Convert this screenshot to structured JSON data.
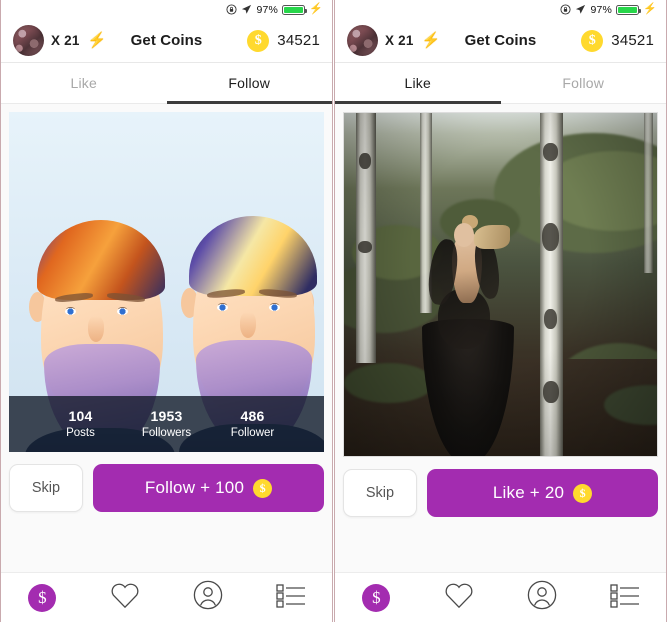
{
  "status_bar": {
    "rotation_lock_icon": "rotation-lock-icon",
    "location_icon": "location-arrow-icon",
    "battery_percent": "97%",
    "battery_icon": "battery-icon",
    "charging_icon": "lightning-bolt-icon",
    "battery_color": "#27d64a"
  },
  "header": {
    "avatar": "user-avatar",
    "level_label": "X 21",
    "bolt_icon": "lightning-bolt-icon",
    "title": "Get Coins",
    "coin_icon": "$",
    "coin_balance": "34521",
    "coin_color": "#ffd92e"
  },
  "panels": [
    {
      "id": "left",
      "tabs": [
        {
          "label": "Like",
          "active": false
        },
        {
          "label": "Follow",
          "active": true
        }
      ],
      "card": {
        "artwork": "two-bearded-men-illustration",
        "stats": [
          {
            "number": "104",
            "label": "Posts"
          },
          {
            "number": "1953",
            "label": "Followers"
          },
          {
            "number": "486",
            "label": "Follower"
          }
        ]
      },
      "actions": {
        "skip_label": "Skip",
        "primary_label": "Follow + 100",
        "primary_coin_icon": "$",
        "primary_color": "#a32cb0"
      }
    },
    {
      "id": "right",
      "tabs": [
        {
          "label": "Like",
          "active": true
        },
        {
          "label": "Follow",
          "active": false
        }
      ],
      "card": {
        "artwork": "woman-black-gown-forest-photo",
        "stats": []
      },
      "actions": {
        "skip_label": "Skip",
        "primary_label": "Like + 20",
        "primary_coin_icon": "$",
        "primary_color": "#a32cb0"
      }
    }
  ],
  "bottom_nav": {
    "items": [
      {
        "icon": "coin-dollar-icon",
        "glyph": "$",
        "active": true
      },
      {
        "icon": "heart-icon",
        "glyph": "",
        "active": false
      },
      {
        "icon": "person-circle-icon",
        "glyph": "",
        "active": false
      },
      {
        "icon": "list-icon",
        "glyph": "",
        "active": false
      }
    ],
    "active_color": "#a32cb0"
  }
}
